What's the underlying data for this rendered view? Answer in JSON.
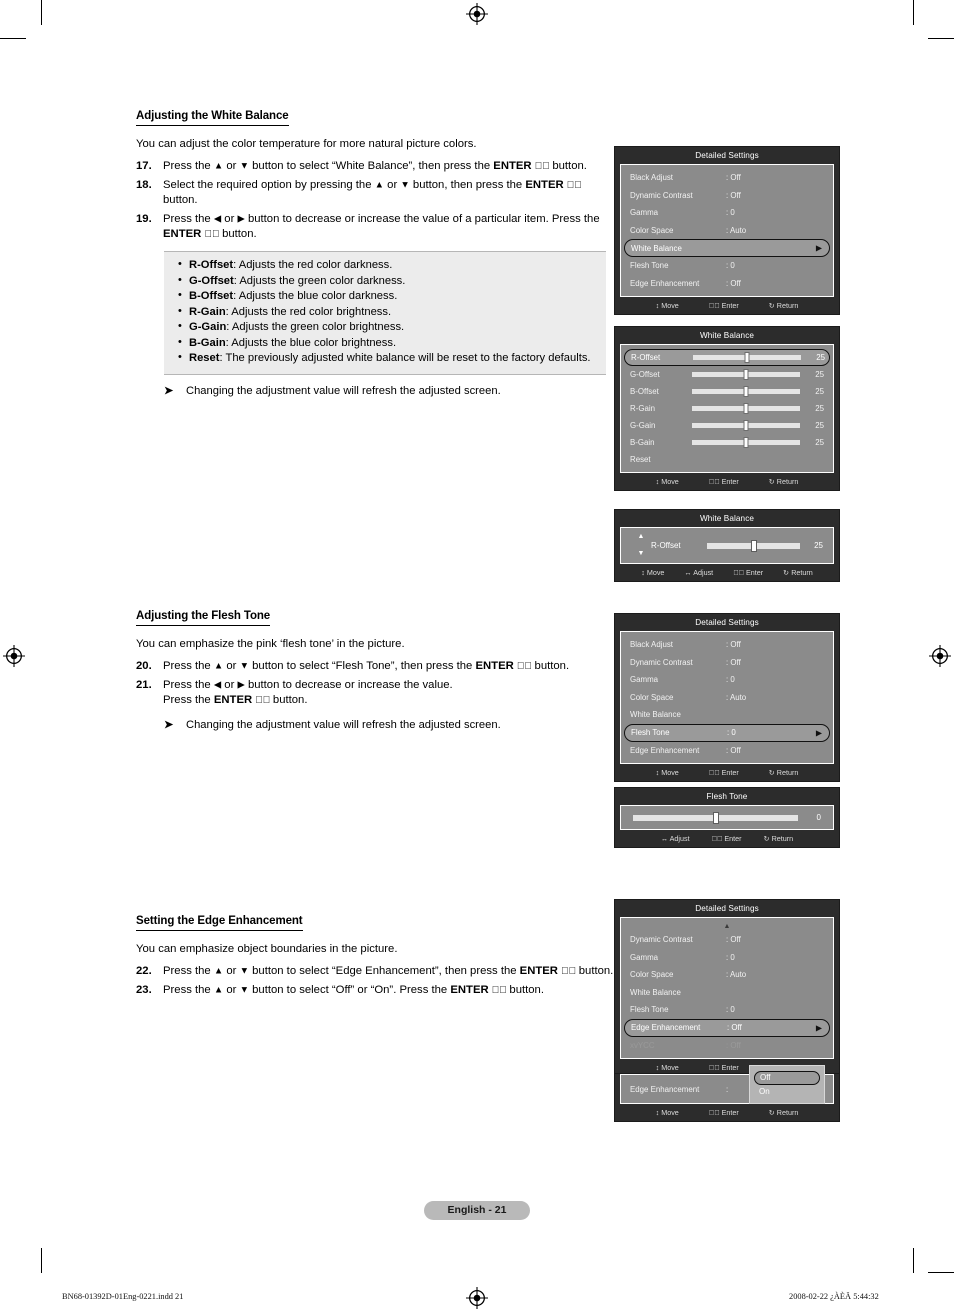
{
  "document": {
    "page_label": "English - 21",
    "print_footer_left": "BN68-01392D-01Eng-0221.indd   21",
    "print_footer_right": "2008-02-22   ¿ÀÈÄ 5:44:32"
  },
  "sections": [
    {
      "heading": "Adjusting the White Balance",
      "intro": "You can adjust the color temperature for more natural picture colors.",
      "steps": [
        {
          "num": "17.",
          "html": "Press the <span class=\"arrowg\">▲</span> or <span class=\"arrowg\">▼</span> button to select “White Balance”, then press the <span class=\"b\">ENTER</span> <span class=\"enterglyph\">↵⃝</span> button."
        },
        {
          "num": "18.",
          "html": "Select the required option by pressing the <span class=\"arrowg\">▲</span> or <span class=\"arrowg\">▼</span> button, then press the <span class=\"b\">ENTER</span> <span class=\"enterglyph\">↵⃝</span> button."
        },
        {
          "num": "19.",
          "html": "Press the <span class=\"arrowg\">◀</span> or <span class=\"arrowg\">▶</span> button to decrease or increase the value of a particular item. Press the <span class=\"b\">ENTER</span> <span class=\"enterglyph\">↵⃝</span> button."
        }
      ],
      "note_items": [
        {
          "term": "R-Offset",
          "desc": ": Adjusts the red color darkness."
        },
        {
          "term": "G-Offset",
          "desc": ": Adjusts the green color darkness."
        },
        {
          "term": "B-Offset",
          "desc": ": Adjusts the blue color darkness."
        },
        {
          "term": "R-Gain",
          "desc": ": Adjusts the red color brightness."
        },
        {
          "term": "G-Gain",
          "desc": ": Adjusts the green color brightness."
        },
        {
          "term": "B-Gain",
          "desc": ": Adjusts the blue color brightness."
        },
        {
          "term": "Reset",
          "desc": ": The previously adjusted white balance will be reset to the factory defaults."
        }
      ],
      "tip": "Changing the adjustment value will refresh the adjusted screen."
    },
    {
      "heading": "Adjusting the Flesh Tone",
      "intro": "You can emphasize the pink ‘flesh tone’ in the picture.",
      "steps": [
        {
          "num": "20.",
          "html": "Press the <span class=\"arrowg\">▲</span> or <span class=\"arrowg\">▼</span> button to select “Flesh Tone”, then press the <span class=\"b\">ENTER</span> <span class=\"enterglyph\">↵⃝</span> button."
        },
        {
          "num": "21.",
          "html": "Press the <span class=\"arrowg\">◀</span> or <span class=\"arrowg\">▶</span> button to decrease or increase the value.<br>Press the <span class=\"b\">ENTER</span> <span class=\"enterglyph\">↵⃝</span> button."
        }
      ],
      "tip": "Changing the adjustment value will refresh the adjusted screen."
    },
    {
      "heading": "Setting the Edge Enhancement",
      "intro": "You can emphasize object boundaries in the picture.",
      "steps": [
        {
          "num": "22.",
          "html": "Press the <span class=\"arrowg\">▲</span> or <span class=\"arrowg\">▼</span> button to select “Edge Enhancement”, then press the <span class=\"b\">ENTER</span> <span class=\"enterglyph\">↵⃝</span> button."
        },
        {
          "num": "23.",
          "html": "Press the <span class=\"arrowg\">▲</span> or <span class=\"arrowg\">▼</span> button to select “Off” or “On”. Press the <span class=\"b\">ENTER</span> <span class=\"enterglyph\">↵⃝</span> button."
        }
      ]
    }
  ],
  "osd_footer": {
    "move": "Move",
    "adjust": "Adjust",
    "enter": "Enter",
    "return": "Return"
  },
  "osd_panels": [
    {
      "id": "detailed-settings-white-balance",
      "title": "Detailed Settings",
      "rows": [
        {
          "label": "Black Adjust",
          "value": ": Off",
          "selected": false
        },
        {
          "label": "Dynamic Contrast",
          "value": ": Off",
          "selected": false
        },
        {
          "label": "Gamma",
          "value": ": 0",
          "selected": false
        },
        {
          "label": "Color Space",
          "value": ": Auto",
          "selected": false
        },
        {
          "label": "White Balance",
          "value": "",
          "selected": true
        },
        {
          "label": "Flesh Tone",
          "value": ": 0",
          "selected": false
        },
        {
          "label": "Edge Enhancement",
          "value": ": Off",
          "selected": false
        }
      ]
    },
    {
      "id": "white-balance-sliders",
      "title": "White Balance",
      "sliders": [
        {
          "label": "R-Offset",
          "value": "25",
          "percent": 50,
          "selected": true
        },
        {
          "label": "G-Offset",
          "value": "25",
          "percent": 50,
          "selected": false
        },
        {
          "label": "B-Offset",
          "value": "25",
          "percent": 50,
          "selected": false
        },
        {
          "label": "R-Gain",
          "value": "25",
          "percent": 50,
          "selected": false
        },
        {
          "label": "G-Gain",
          "value": "25",
          "percent": 50,
          "selected": false
        },
        {
          "label": "B-Gain",
          "value": "25",
          "percent": 50,
          "selected": false
        }
      ],
      "reset_label": "Reset"
    },
    {
      "id": "white-balance-adjust",
      "title": "White Balance",
      "adjust": {
        "label": "R-Offset",
        "value": "25",
        "percent": 50,
        "show_updown": true
      }
    },
    {
      "id": "detailed-settings-flesh-tone",
      "title": "Detailed Settings",
      "rows": [
        {
          "label": "Black Adjust",
          "value": ": Off",
          "selected": false
        },
        {
          "label": "Dynamic Contrast",
          "value": ": Off",
          "selected": false
        },
        {
          "label": "Gamma",
          "value": ": 0",
          "selected": false
        },
        {
          "label": "Color Space",
          "value": ": Auto",
          "selected": false
        },
        {
          "label": "White Balance",
          "value": "",
          "selected": false
        },
        {
          "label": "Flesh Tone",
          "value": ": 0",
          "selected": true
        },
        {
          "label": "Edge Enhancement",
          "value": ": Off",
          "selected": false
        }
      ]
    },
    {
      "id": "flesh-tone-adjust",
      "title": "Flesh Tone",
      "adjust": {
        "label": "",
        "value": "0",
        "percent": 50,
        "show_updown": false
      }
    },
    {
      "id": "detailed-settings-edge-enhancement",
      "title": "Detailed Settings",
      "scroll_up": true,
      "rows": [
        {
          "label": "Dynamic Contrast",
          "value": ": Off",
          "selected": false
        },
        {
          "label": "Gamma",
          "value": ": 0",
          "selected": false
        },
        {
          "label": "Color Space",
          "value": ": Auto",
          "selected": false
        },
        {
          "label": "White Balance",
          "value": "",
          "selected": false
        },
        {
          "label": "Flesh Tone",
          "value": ": 0",
          "selected": false
        },
        {
          "label": "Edge Enhancement",
          "value": ": Off",
          "selected": true
        },
        {
          "label": "xvYCC",
          "value": ": Off",
          "selected": false,
          "dim": true
        }
      ]
    },
    {
      "id": "edge-enhancement-dropdown",
      "title": "",
      "dropdown_row_label": "Edge Enhancement",
      "dropdown_row_colon": ":",
      "dropdown_options": [
        {
          "label": "Off",
          "selected": true
        },
        {
          "label": "On",
          "selected": false
        }
      ]
    }
  ]
}
